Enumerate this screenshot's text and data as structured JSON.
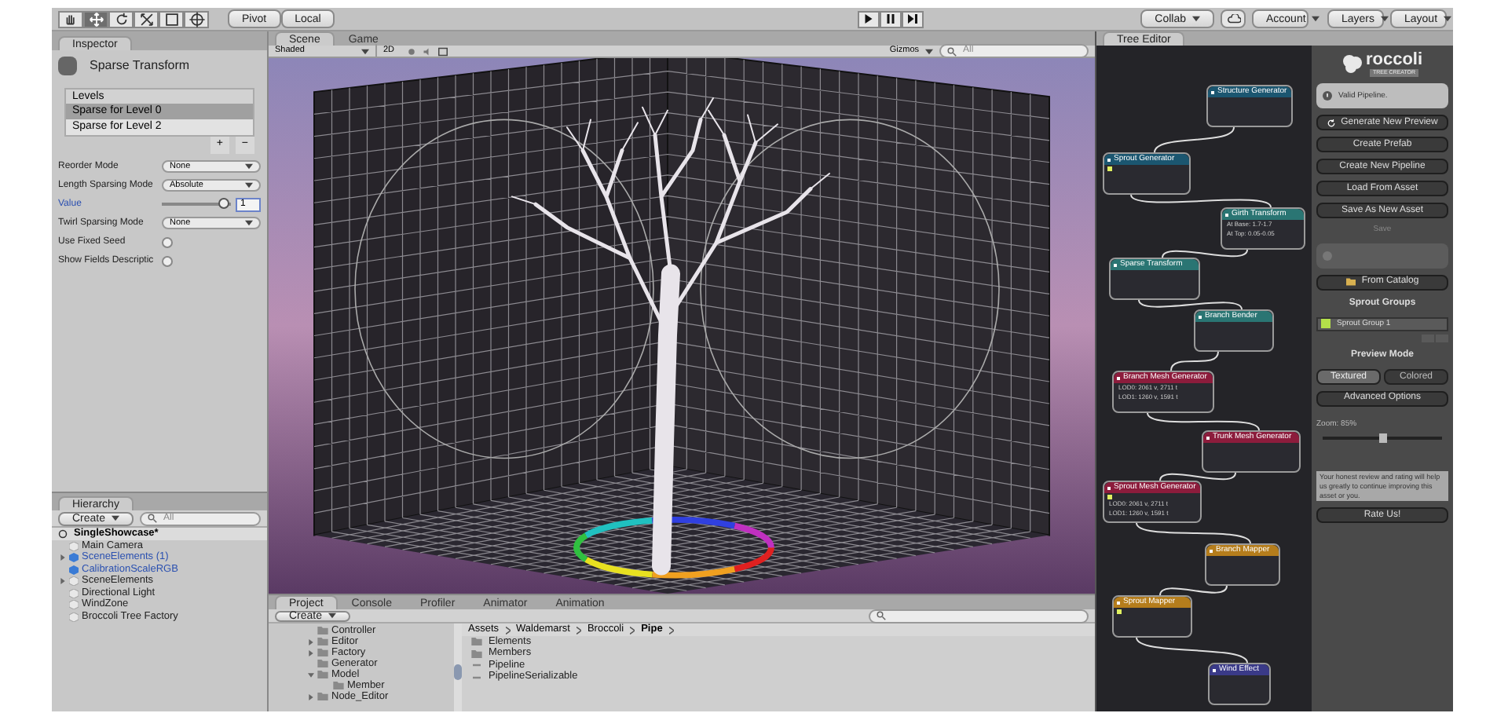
{
  "toolbar": {
    "tools": [
      {
        "kind": "hand",
        "selected": false
      },
      {
        "kind": "move",
        "selected": true
      },
      {
        "kind": "rotate",
        "selected": false
      },
      {
        "kind": "scale",
        "selected": false
      },
      {
        "kind": "rect",
        "selected": false
      },
      {
        "kind": "transform",
        "selected": false
      }
    ],
    "pivot": "Pivot",
    "local": "Local",
    "collab": "Collab",
    "account": "Account",
    "layers": "Layers",
    "layout": "Layout"
  },
  "inspector": {
    "tab": "Inspector",
    "component": "Sparse Transform",
    "list_header": "Levels",
    "list_buttons": [
      "+",
      "−"
    ],
    "levels": [
      {
        "label": "Sparse for Level 0",
        "selected": true
      },
      {
        "label": "Sparse for Level 2",
        "selected": false
      }
    ],
    "fields": [
      {
        "kind": "dropdown",
        "label": "Reorder Mode",
        "value": "None"
      },
      {
        "kind": "dropdown",
        "label": "Length Sparsing Mode",
        "value": "Absolute"
      },
      {
        "kind": "slider",
        "label": "Value",
        "level": 0.97,
        "value": "1"
      },
      {
        "kind": "dropdown",
        "label": "Twirl Sparsing Mode",
        "value": "None"
      },
      {
        "kind": "checkbox",
        "label": "Use Fixed Seed",
        "checked": false
      },
      {
        "kind": "checkbox",
        "label": "Show Fields Descriptic",
        "checked": false
      }
    ]
  },
  "hierarchy": {
    "tab": "Hierarchy",
    "create": "Create",
    "search_placeholder": "All",
    "root": "SingleShowcase*",
    "items": [
      {
        "label": "Main Camera",
        "kind": "object"
      },
      {
        "label": "SceneElements (1)",
        "kind": "prefab",
        "expanded": false
      },
      {
        "label": "CalibrationScaleRGB",
        "kind": "prefab"
      },
      {
        "label": "SceneElements",
        "kind": "object",
        "expanded": false
      },
      {
        "label": "Directional Light",
        "kind": "object"
      },
      {
        "label": "WindZone",
        "kind": "object"
      },
      {
        "label": "Broccoli Tree Factory",
        "kind": "object"
      }
    ]
  },
  "scene": {
    "tabs": [
      {
        "label": "Scene",
        "selected": true
      },
      {
        "label": "Game",
        "selected": false
      }
    ],
    "shading": "Shaded",
    "mode_2d": "2D",
    "gizmos": "Gizmos",
    "search_placeholder": "All"
  },
  "project": {
    "tabs": [
      {
        "label": "Project",
        "selected": true
      },
      {
        "label": "Console",
        "selected": false
      },
      {
        "label": "Profiler",
        "selected": false
      },
      {
        "label": "Animator",
        "selected": false
      },
      {
        "label": "Animation",
        "selected": false
      }
    ],
    "create": "Create",
    "folders": [
      {
        "label": "Controller"
      },
      {
        "label": "Editor",
        "expanded": false
      },
      {
        "label": "Factory",
        "expanded": false
      },
      {
        "label": "Generator"
      },
      {
        "label": "Model",
        "expanded": true,
        "children": [
          {
            "label": "Member"
          }
        ]
      },
      {
        "label": "Node_Editor",
        "expanded": false
      }
    ],
    "breadcrumb": [
      "Assets",
      "Waldemarst",
      "Broccoli",
      "Pipe"
    ],
    "items": [
      {
        "kind": "folder",
        "label": "Elements"
      },
      {
        "kind": "folder",
        "label": "Members"
      },
      {
        "kind": "script",
        "label": "Pipeline"
      },
      {
        "kind": "script",
        "label": "PipelineSerializable"
      }
    ]
  },
  "tree_editor": {
    "tab": "Tree Editor",
    "nodes": [
      {
        "title": "Structure Generator",
        "kind": "generator",
        "port": false
      },
      {
        "title": "Sprout Generator",
        "kind": "generator",
        "port": true
      },
      {
        "title": "Girth Transform",
        "kind": "transform",
        "port": false,
        "lines": [
          "At Base: 1.7-1.7",
          "At Top: 0.05-0.05"
        ]
      },
      {
        "title": "Sparse Transform",
        "kind": "transform",
        "port": false
      },
      {
        "title": "Branch Bender",
        "kind": "transform",
        "port": false
      },
      {
        "title": "Branch Mesh Generator",
        "kind": "mesh",
        "port": false,
        "lines": [
          "LOD0: 2061 v, 2711 t",
          "LOD1: 1260 v, 1591 t"
        ]
      },
      {
        "title": "Trunk Mesh Generator",
        "kind": "mesh",
        "port": false
      },
      {
        "title": "Sprout Mesh Generator",
        "kind": "mesh",
        "port": true,
        "lines": [
          "LOD0: 2061 v, 2711 t",
          "LOD1: 1260 v, 1591 t"
        ]
      },
      {
        "title": "Branch Mapper",
        "kind": "mapper",
        "port": false
      },
      {
        "title": "Sprout Mapper",
        "kind": "mapper",
        "port": true
      },
      {
        "title": "Wind Effect",
        "kind": "effect",
        "port": false
      }
    ],
    "logo": "roccoli",
    "logo_subtitle": "TREE CREATOR",
    "status": "Valid Pipeline.",
    "buttons": [
      {
        "label": "Generate New Preview",
        "kind": "refresh"
      },
      {
        "label": "Create Prefab",
        "kind": "plain"
      },
      {
        "label": "Create New Pipeline",
        "kind": "plain"
      },
      {
        "label": "Load From Asset",
        "kind": "plain"
      },
      {
        "label": "Save As New Asset",
        "kind": "plain"
      }
    ],
    "save": "Save",
    "catalog": "From Catalog",
    "sprout_groups_title": "Sprout Groups",
    "sprout_groups": [
      {
        "label": "Sprout Group 1",
        "color": "#b4e04a"
      }
    ],
    "preview_title": "Preview Mode",
    "preview_modes": [
      {
        "label": "Textured",
        "selected": true
      },
      {
        "label": "Colored",
        "selected": false
      }
    ],
    "advanced": "Advanced Options",
    "zoom_label": "Zoom: 85%",
    "zoom": {
      "level": 0.5
    },
    "rate_text": "Your honest review and rating will help us greatly to continue improving this asset or you.",
    "rate_button": "Rate Us!"
  }
}
